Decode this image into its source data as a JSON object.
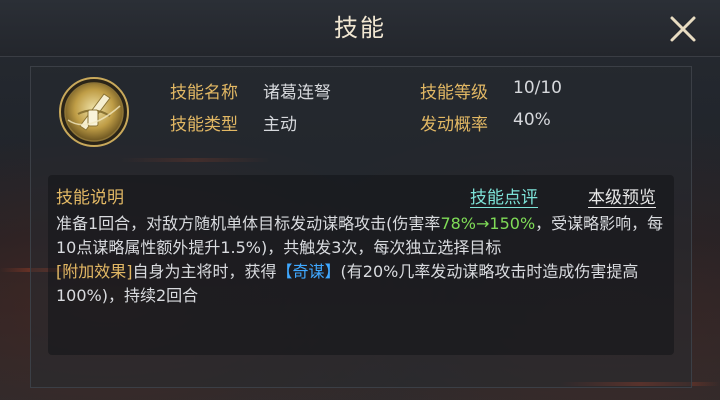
{
  "header": {
    "title": "技能"
  },
  "skill": {
    "name_label": "技能名称",
    "name": "诸葛连弩",
    "type_label": "技能类型",
    "type": "主动",
    "level_label": "技能等级",
    "level": "10/10",
    "prob_label": "发动概率",
    "prob": "40%"
  },
  "description": {
    "title": "技能说明",
    "tab_review": "技能点评",
    "tab_preview": "本级预览",
    "line1_part1": "准备1回合，对敌方随机单体目标发动谋略攻击(伤害率",
    "line1_rate": "78%→150%",
    "line1_part2": "，受谋略影响，每10点谋略属性额外提升1.5%)，共触发3次，每次独立选择目标",
    "extra_tag": "[附加效果]",
    "extra_part1": "自身为主将时，获得",
    "extra_buff": "【奇谋】",
    "extra_part2": "(有20%几率发动谋略攻击时造成伤害提高100%)，持续2回合"
  },
  "colors": {
    "label_gold": "#e2b864",
    "highlight_green": "#7fdc57",
    "buff_blue": "#3fa8ff",
    "active_tab": "#7de3d8"
  },
  "icons": {
    "close": "close-icon",
    "skill": "crossbow-skill-icon"
  }
}
